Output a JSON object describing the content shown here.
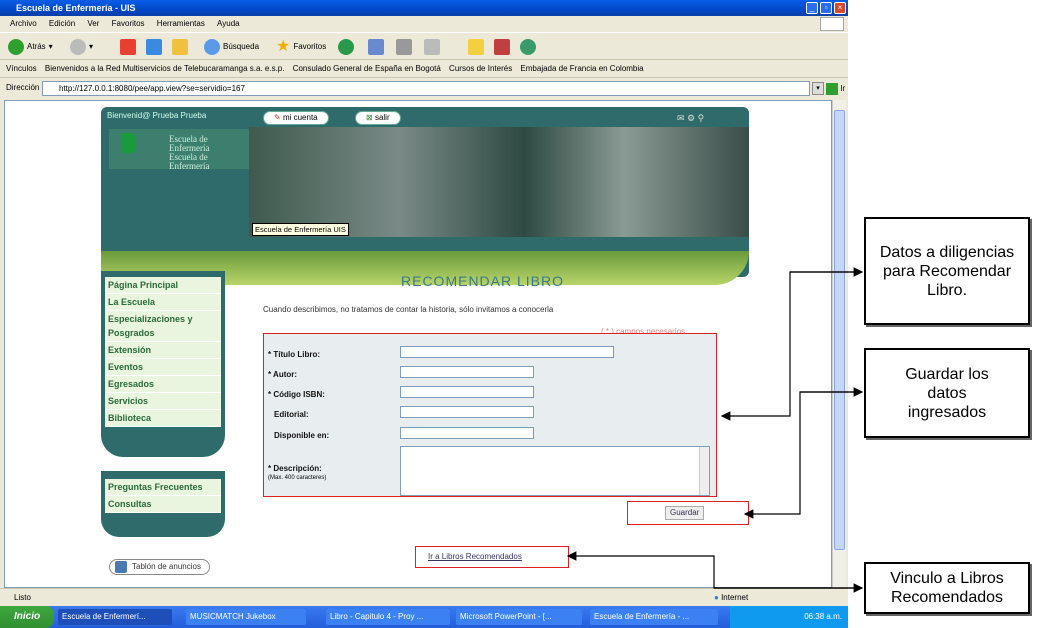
{
  "window": {
    "title": "Escuela de Enfermería - UIS",
    "menu": [
      "Archivo",
      "Edición",
      "Ver",
      "Favoritos",
      "Herramientas",
      "Ayuda"
    ],
    "toolbar": {
      "back": "Atrás",
      "search": "Búsqueda",
      "favorites": "Favoritos"
    },
    "links_label": "Vínculos",
    "links": [
      "Bienvenidos a la Red Multiservicios de Telebucaramanga s.a. e.s.p.",
      "Consulado General de España en Bogotá",
      "Cursos de Interés",
      "Embajada de Francia en Colombia"
    ],
    "address_label": "Dirección",
    "address": "http://127.0.0.1:8080/pee/app.view?se=servidio=167",
    "go_label": "Ir",
    "status_left": "Listo",
    "status_right": "Internet"
  },
  "taskbar": {
    "start": "Inicio",
    "tasks": [
      "Escuela de Enfermerí...",
      "MUSICMATCH Jukebox",
      "Libro - Capitulo 4 - Proy ...",
      "Microsoft PowerPoint - [...",
      "Escuela de Enfermería - ..."
    ],
    "clock": "06:38 a.m."
  },
  "page": {
    "welcome": "Bienvenid@ Prueba Prueba",
    "mi_cuenta": "mi cuenta",
    "salir": "salir",
    "logo_line1": "Escuela de Enfermería",
    "logo_line2": "Escuela de Enfermería",
    "tooltip": "Escuela de Enfermería UIS",
    "nav": [
      "Página Principal",
      "La Escuela",
      "Especializaciones y Posgrados",
      "Extensión",
      "Eventos",
      "Egresados",
      "Servicios",
      "Biblioteca"
    ],
    "nav2": [
      "Preguntas Frecuentes",
      "Consultas"
    ],
    "tablon": "Tablón de anuncios",
    "heading": "RECOMENDAR LIBRO",
    "intro": "Cuando describimos, no tratamos de contar la historia, sólo invitamos a conocerla",
    "required_note": "( * ) campos necesarios",
    "fields": {
      "titulo": "* Título Libro:",
      "autor": "* Autor:",
      "isbn": "* Código ISBN:",
      "editorial": "Editorial:",
      "disponible": "Disponible en:",
      "descripcion": "* Descripción:",
      "descripcion_note": "(Max. 400 caracteres)"
    },
    "guardar": "Guardar",
    "link_recomendados": "Ir a Libros Recomendados"
  },
  "callouts": {
    "datos": "Datos a diligencias para Recomendar Libro.",
    "guardar": "Guardar los datos ingresados",
    "vinculo": "Vinculo a Libros Recomendados"
  }
}
